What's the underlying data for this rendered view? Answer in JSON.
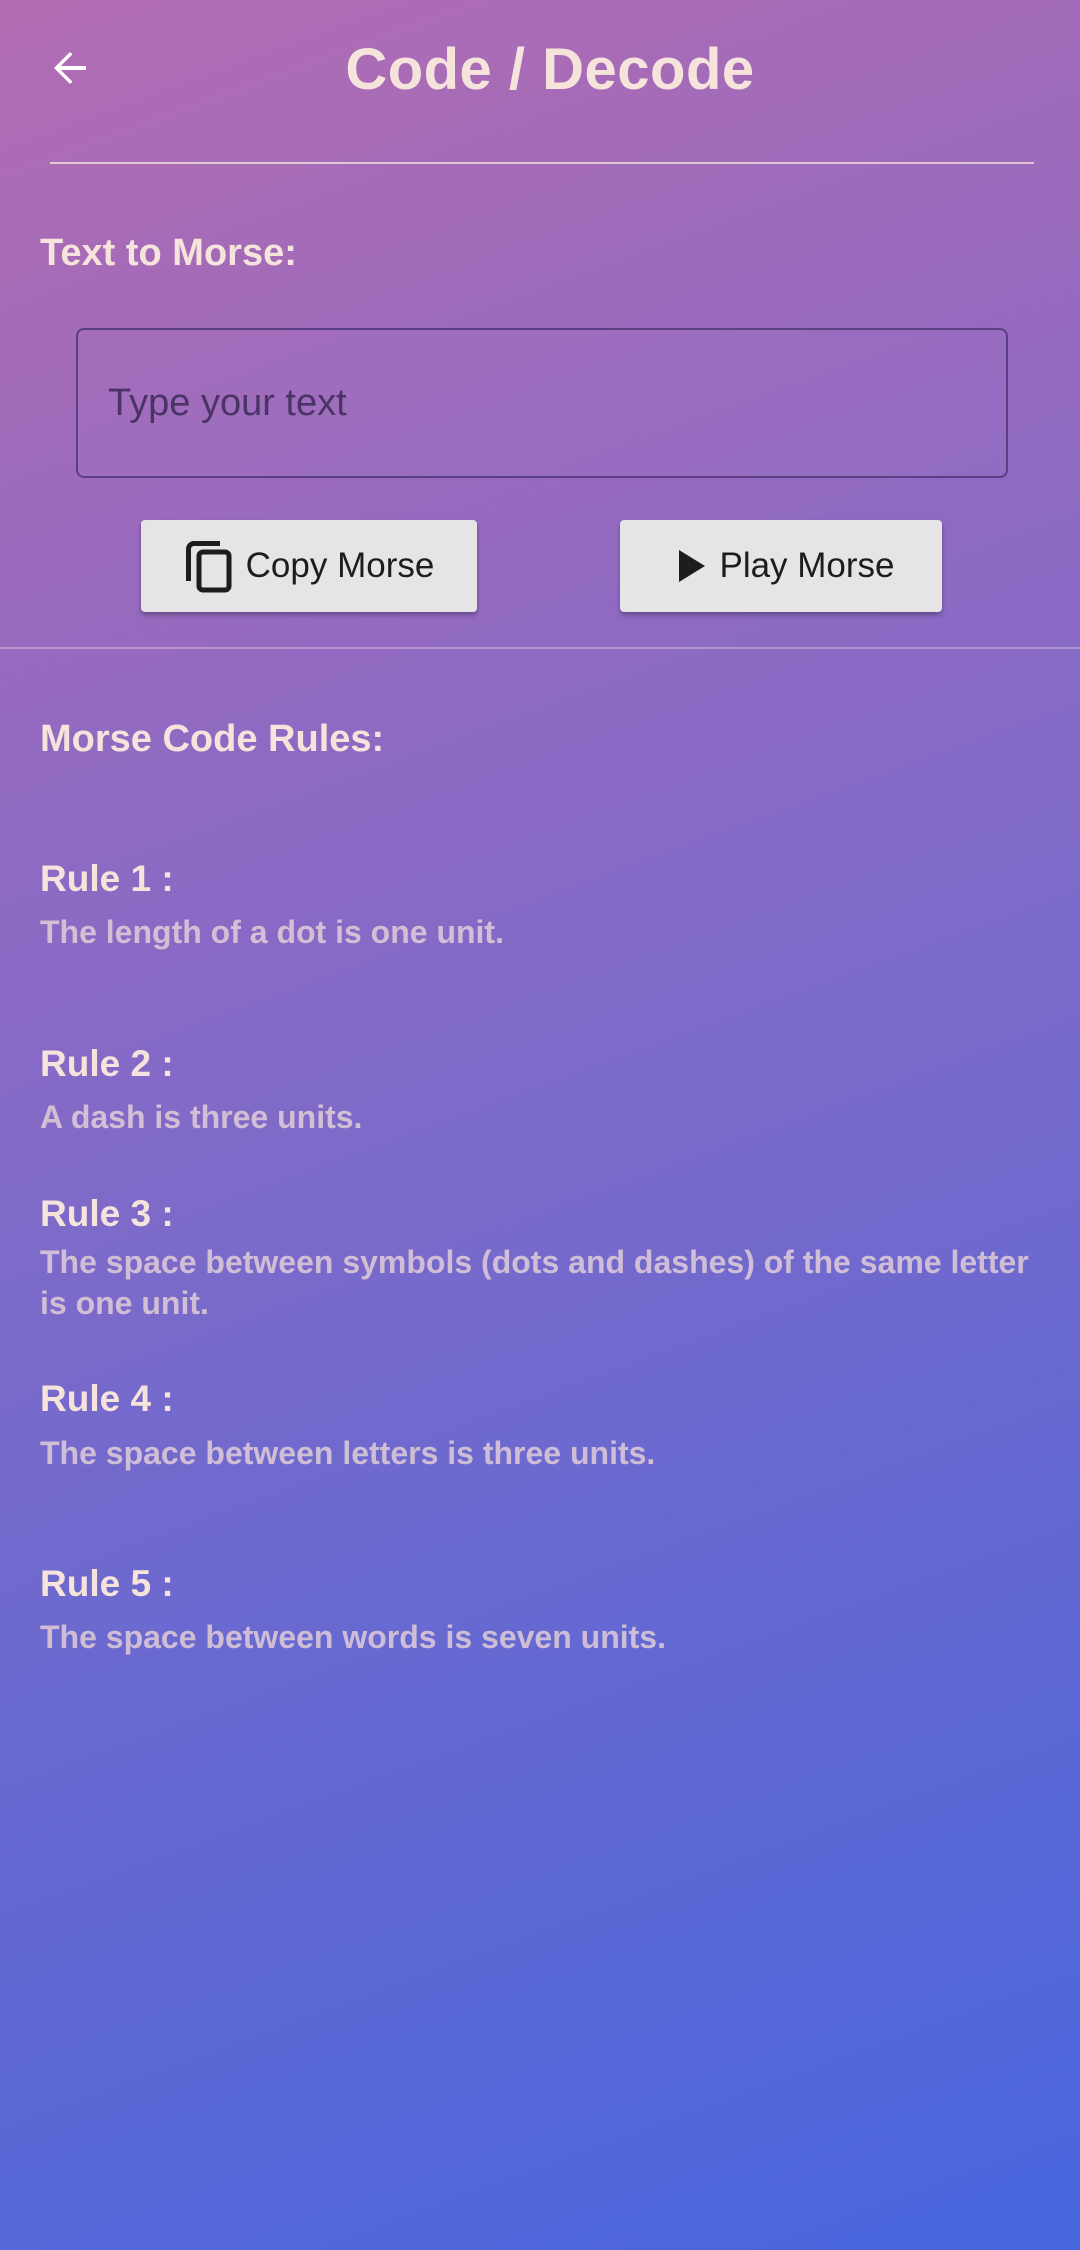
{
  "header": {
    "title": "Code / Decode",
    "back_icon": "arrow-back-icon"
  },
  "text_to_morse": {
    "label": "Text to Morse:",
    "input_value": "",
    "input_placeholder": "Type your text"
  },
  "buttons": {
    "copy_label": "Copy Morse",
    "copy_icon": "copy-icon",
    "play_label": "Play Morse",
    "play_icon": "play-icon"
  },
  "rules_section": {
    "label": "Morse Code Rules:",
    "rules": [
      {
        "title": "Rule 1 :",
        "text": "The length of a dot is one unit."
      },
      {
        "title": "Rule 2 :",
        "text": "A dash is three units."
      },
      {
        "title": "Rule 3 :",
        "text": "The space between symbols (dots and dashes) of the same letter is one unit."
      },
      {
        "title": "Rule 4 :",
        "text": "The space between letters is three units."
      },
      {
        "title": "Rule 5 :",
        "text": "The space between words is seven units."
      }
    ]
  },
  "colors": {
    "gradient_start": "#b36cb2",
    "gradient_end": "#4766dd",
    "title_text": "#f6e4dc",
    "button_bg": "#e6e4e6"
  }
}
